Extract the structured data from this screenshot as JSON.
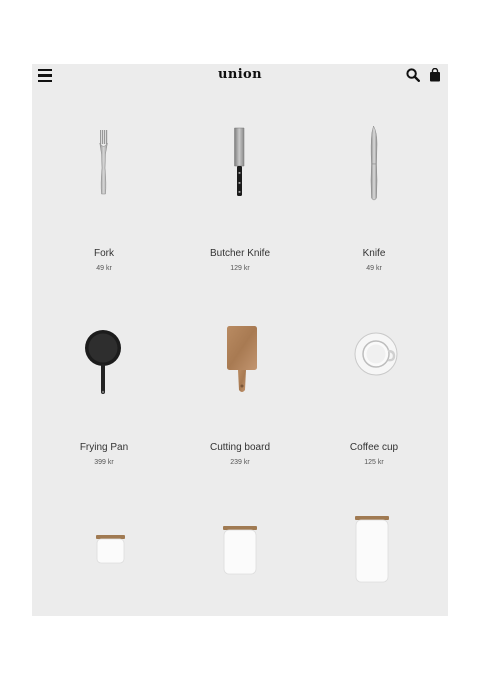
{
  "header": {
    "logo_text": "union",
    "menu_icon": "hamburger-icon",
    "search_icon": "search-icon",
    "cart_icon": "shopping-bag-icon"
  },
  "products": [
    {
      "name": "Fork",
      "price": "49 kr",
      "icon": "fork-image"
    },
    {
      "name": "Butcher Knife",
      "price": "129 kr",
      "icon": "butcher-knife-image"
    },
    {
      "name": "Knife",
      "price": "49 kr",
      "icon": "knife-image"
    },
    {
      "name": "Frying Pan",
      "price": "399 kr",
      "icon": "frying-pan-image"
    },
    {
      "name": "Cutting board",
      "price": "239 kr",
      "icon": "cutting-board-image"
    },
    {
      "name": "Coffee cup",
      "price": "125 kr",
      "icon": "coffee-cup-image"
    },
    {
      "name": "",
      "price": "",
      "icon": "small-jar-image"
    },
    {
      "name": "",
      "price": "",
      "icon": "medium-jar-image"
    },
    {
      "name": "",
      "price": "",
      "icon": "large-jar-image"
    }
  ]
}
